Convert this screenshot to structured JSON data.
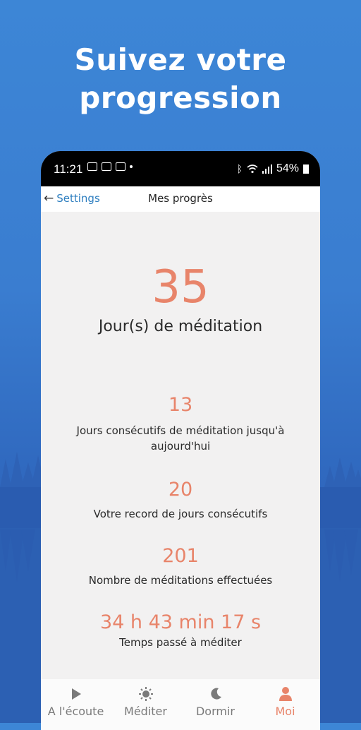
{
  "hero": {
    "line1": "Suivez votre",
    "line2": "progression"
  },
  "status_bar": {
    "time": "11:21",
    "battery": "54%"
  },
  "nav": {
    "back_label": "Settings",
    "title": "Mes progrès"
  },
  "stats": {
    "total_days": {
      "value": "35",
      "label": "Jour(s) de méditation"
    },
    "streak": {
      "value": "13",
      "label": "Jours consécutifs de méditation jusqu'à aujourd'hui"
    },
    "record": {
      "value": "20",
      "label": "Votre record de jours consécutifs"
    },
    "sessions": {
      "value": "201",
      "label": "Nombre de méditations effectuées"
    },
    "time": {
      "value": "34 h 43 min 17 s",
      "label": "Temps passé à méditer"
    }
  },
  "tabs": [
    {
      "label": "A l'écoute",
      "icon": "play-icon"
    },
    {
      "label": "Méditer",
      "icon": "sun-icon"
    },
    {
      "label": "Dormir",
      "icon": "moon-icon"
    },
    {
      "label": "Moi",
      "icon": "person-icon"
    }
  ],
  "colors": {
    "accent": "#e8846a",
    "link": "#2f7fc0",
    "background": "#3d86d6"
  }
}
